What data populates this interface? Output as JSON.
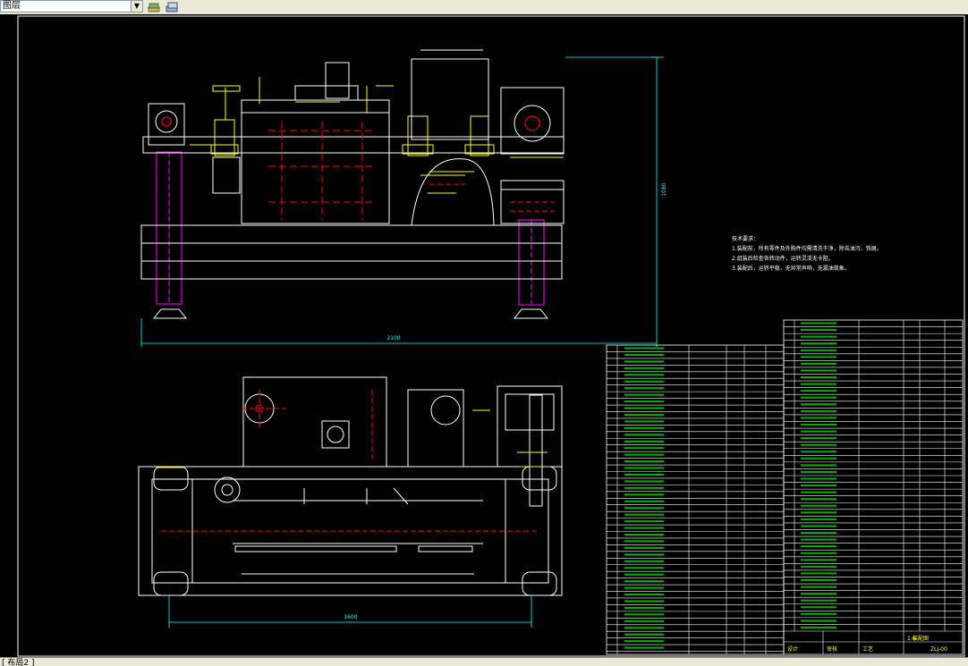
{
  "toolbar": {
    "layer_value": "图层",
    "layer_icon": "layer-states-icon",
    "layer_prev_icon": "layer-previous-icon"
  },
  "drawing": {
    "dim_height": "1080",
    "dim_width_front": "2100",
    "dim_width_plan": "1600",
    "notes": [
      "技术要求：",
      "1.装配前，所有零件及外购件均需清洗干净，除去油污、铁屑。",
      "2.组装后检查各转动件，运转灵活无卡阻。",
      "3.装配后，运转平稳，无异常声响，无漏油现象。"
    ],
    "title_block": {
      "label1": "标记",
      "label2": "处数",
      "label3": "设计",
      "label4": "审核",
      "label5": "工艺",
      "drawing_no": "ZLJ-00",
      "scale": "1:6",
      "material": "装配图"
    }
  },
  "status": {
    "text": "[ 布局2 ]"
  },
  "colors": {
    "background": "#000000",
    "line_white": "#ffffff",
    "line_yellow": "#ffff00",
    "line_red": "#ff0000",
    "line_magenta": "#ff00ff",
    "line_green": "#00ff00",
    "line_cyan": "#00ffff"
  }
}
